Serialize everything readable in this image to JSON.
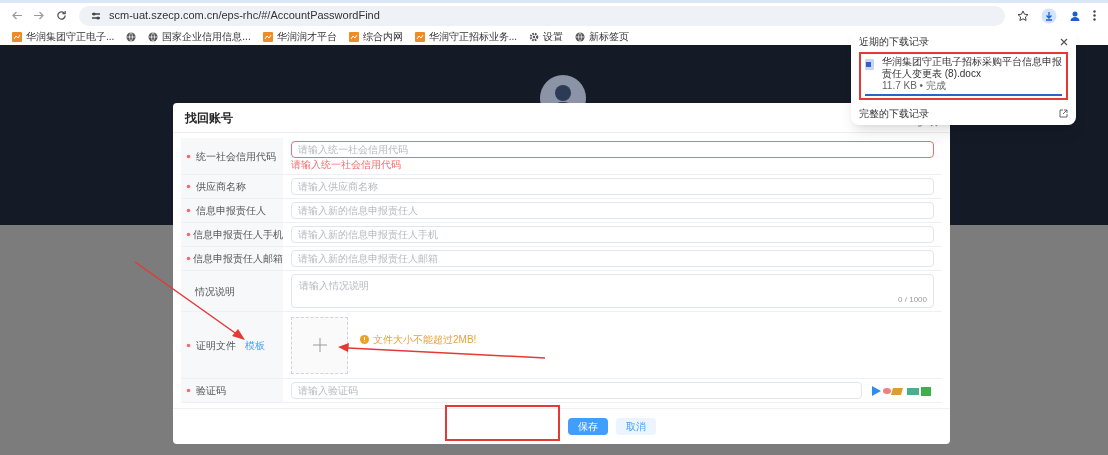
{
  "browser": {
    "url": "scm-uat.szecp.com.cn/eps-rhc/#/AccountPasswordFind",
    "bookmarks": [
      {
        "kind": "logo",
        "label": "华润集团守正电子..."
      },
      {
        "kind": "globe"
      },
      {
        "kind": "globe",
        "label": "国家企业信用信息..."
      },
      {
        "kind": "logo",
        "label": "华润润才平台"
      },
      {
        "kind": "logo",
        "label": "综合内网"
      },
      {
        "kind": "logo",
        "label": "华润守正招标业务..."
      },
      {
        "kind": "gear",
        "label": "设置"
      },
      {
        "kind": "globe",
        "label": "新标签页"
      }
    ]
  },
  "downloads_popup": {
    "title": "近期的下载记录",
    "items": [
      {
        "name": "华润集团守正电子招标采购平台信息申报责任人变更表 (8).docx",
        "details": "11.7 KB • 完成",
        "level": 1
      }
    ],
    "footer": "完整的下载记录"
  },
  "dialog": {
    "title": "找回账号",
    "fields": [
      {
        "kind": "input",
        "label": "统一社会信用代码",
        "required": true,
        "placeholder": "请输入统一社会信用代码",
        "invalid": true,
        "error": "请输入统一社会信用代码"
      },
      {
        "kind": "input",
        "label": "供应商名称",
        "required": true,
        "placeholder": "请输入供应商名称",
        "invalid": false
      },
      {
        "kind": "input",
        "label": "信息申报责任人",
        "required": true,
        "placeholder": "请输入新的信息申报责任人",
        "invalid": false
      },
      {
        "kind": "input",
        "label": "信息申报责任人手机",
        "required": true,
        "placeholder": "请输入新的信息申报责任人手机",
        "invalid": false
      },
      {
        "kind": "input",
        "label": "信息申报责任人邮箱",
        "required": true,
        "placeholder": "请输入新的信息申报责任人邮箱",
        "invalid": false
      },
      {
        "kind": "textarea",
        "label": "情况说明",
        "required": false,
        "placeholder": "请输入情况说明",
        "counter": "0 / 1000"
      },
      {
        "kind": "upload",
        "label": "证明文件",
        "required": true,
        "link": "模板",
        "hint": "文件大小不能超过2MB!"
      },
      {
        "kind": "captcha",
        "label": "验证码",
        "required": true,
        "placeholder": "请输入验证码",
        "invalid": false
      }
    ],
    "buttons": [
      {
        "kind": "primary",
        "label": "保存"
      },
      {
        "kind": "secondary",
        "label": "取消"
      }
    ]
  }
}
